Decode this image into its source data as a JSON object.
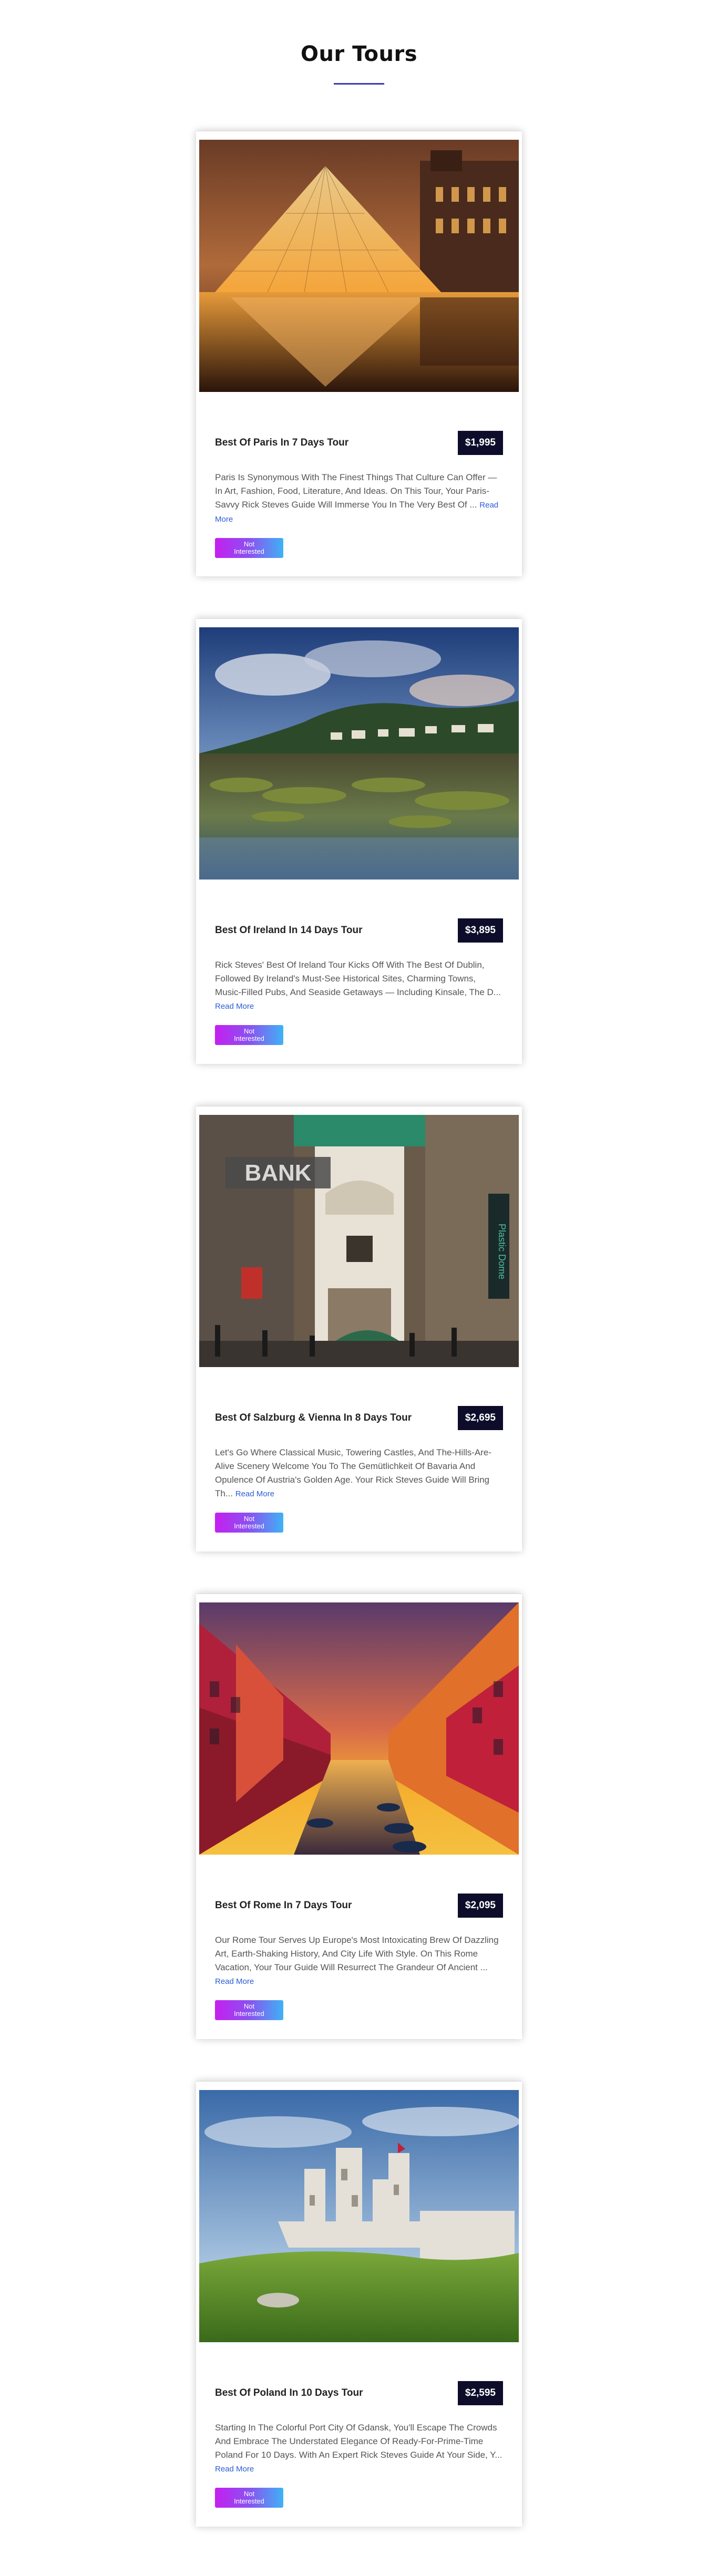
{
  "page": {
    "title": "Our Tours"
  },
  "tours": [
    {
      "name": "Best Of Paris In 7 Days Tour",
      "price": "$1,995",
      "description": "Paris Is Synonymous With The Finest Things That Culture Can Offer — In Art, Fashion, Food, Literature, And Ideas. On This Tour, Your Paris-Savvy Rick Steves Guide Will Immerse You In The Very Best Of ...",
      "read_more": "Read More",
      "button": "Not Interested",
      "image": "louvre-pyramid-image"
    },
    {
      "name": "Best Of Ireland In 14 Days Tour",
      "price": "$3,895",
      "description": "Rick Steves' Best Of Ireland Tour Kicks Off With The Best Of Dublin, Followed By Ireland's Must-See Historical Sites, Charming Towns, Music-Filled Pubs, And Seaside Getaways — Including Kinsale, The D...",
      "read_more": "Read More",
      "button": "Not Interested",
      "image": "irish-coast-image"
    },
    {
      "name": "Best Of Salzburg & Vienna In 8 Days Tour",
      "price": "$2,695",
      "description": "Let's Go Where Classical Music, Towering Castles, And The-Hills-Are-Alive Scenery Welcome You To The Gemütlichkeit Of Bavaria And Opulence Of Austria's Golden Age. Your Rick Steves Guide Will Bring Th...",
      "read_more": "Read More",
      "button": "Not Interested",
      "image": "vienna-street-image"
    },
    {
      "name": "Best Of Rome In 7 Days Tour",
      "price": "$2,095",
      "description": "Our Rome Tour Serves Up Europe's Most Intoxicating Brew Of Dazzling Art, Earth-Shaking History, And City Life With Style. On This Rome Vacation, Your Tour Guide Will Resurrect The Grandeur Of Ancient ...",
      "read_more": "Read More",
      "button": "Not Interested",
      "image": "canal-sunset-image"
    },
    {
      "name": "Best Of Poland In 10 Days Tour",
      "price": "$2,595",
      "description": "Starting In The Colorful Port City Of Gdansk, You'll Escape The Crowds And Embrace The Understated Elegance Of Ready-For-Prime-Time Poland For 10 Days. With An Expert Rick Steves Guide At Your Side, Y...",
      "read_more": "Read More",
      "button": "Not Interested",
      "image": "castle-ruins-image"
    }
  ]
}
